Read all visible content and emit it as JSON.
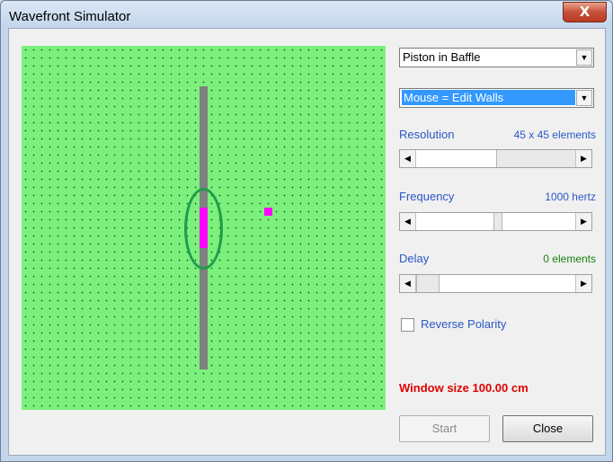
{
  "window": {
    "title": "Wavefront Simulator",
    "close_glyph": "X"
  },
  "source_select": {
    "value": "Piston in Baffle"
  },
  "mouse_select": {
    "value": "Mouse = Edit Walls"
  },
  "resolution": {
    "label": "Resolution",
    "value_text": "45 x 45 elements",
    "level": 0.2
  },
  "frequency": {
    "label": "Frequency",
    "value_text": "1000 hertz",
    "level": 0.45
  },
  "delay": {
    "label": "Delay",
    "value_text": "0 elements",
    "level": 0.0
  },
  "reverse_polarity": {
    "label": "Reverse Polarity",
    "checked": false
  },
  "status": {
    "window_size": "Window size 100.00 cm"
  },
  "buttons": {
    "start": "Start",
    "close": "Close"
  },
  "icons": {
    "scroll_left": "◀",
    "scroll_right": "▶",
    "dropdown": "▼"
  },
  "colors": {
    "field": "#7cf07c",
    "wall": "#808080",
    "source": "#ff00ff",
    "highlight": "#1e9e4a"
  }
}
